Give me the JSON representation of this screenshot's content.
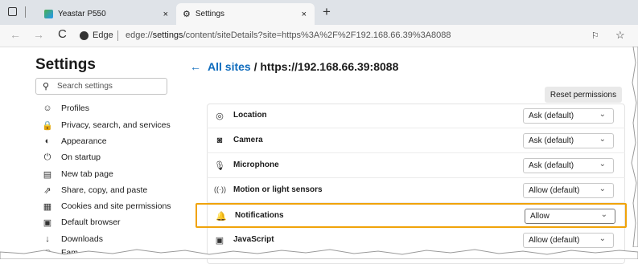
{
  "browser": {
    "tabs": [
      {
        "label": "Yeastar P550",
        "close": "×"
      },
      {
        "label": "Settings",
        "close": "×"
      }
    ],
    "new_tab": "+",
    "nav": {
      "back": "←",
      "forward": "→",
      "reload": "C"
    },
    "site_label": "Edge",
    "url_prefix": "edge://",
    "url_host": "settings",
    "url_rest": "/content/siteDetails?site=https%3A%2F%2F192.168.66.39%3A8088"
  },
  "sidebar": {
    "title": "Settings",
    "search_placeholder": "Search settings",
    "items": [
      {
        "label": "Profiles",
        "icon": "profile-icon"
      },
      {
        "label": "Privacy, search, and services",
        "icon": "lock-icon"
      },
      {
        "label": "Appearance",
        "icon": "palette-icon"
      },
      {
        "label": "On startup",
        "icon": "power-icon"
      },
      {
        "label": "New tab page",
        "icon": "newtab-icon"
      },
      {
        "label": "Share, copy, and paste",
        "icon": "share-icon"
      },
      {
        "label": "Cookies and site permissions",
        "icon": "cookies-icon"
      },
      {
        "label": "Default browser",
        "icon": "browser-icon"
      },
      {
        "label": "Downloads",
        "icon": "download-icon"
      },
      {
        "label": "Fam",
        "icon": "family-icon"
      }
    ]
  },
  "main": {
    "breadcrumb_link": "All sites",
    "breadcrumb_sep": " / ",
    "breadcrumb_current": "https://192.168.66.39:8088",
    "reset_label": "Reset permissions",
    "permissions": [
      {
        "label": "Location",
        "value": "Ask (default)",
        "icon": "location-icon"
      },
      {
        "label": "Camera",
        "value": "Ask (default)",
        "icon": "camera-icon"
      },
      {
        "label": "Microphone",
        "value": "Ask (default)",
        "icon": "microphone-icon"
      },
      {
        "label": "Motion or light sensors",
        "value": "Allow (default)",
        "icon": "sensor-icon"
      },
      {
        "label": "Notifications",
        "value": "Allow",
        "icon": "bell-icon"
      },
      {
        "label": "JavaScript",
        "value": "Allow (default)",
        "icon": "javascript-icon"
      }
    ]
  },
  "colors": {
    "accent": "#0f6cbd",
    "highlight": "#f0a30a"
  }
}
